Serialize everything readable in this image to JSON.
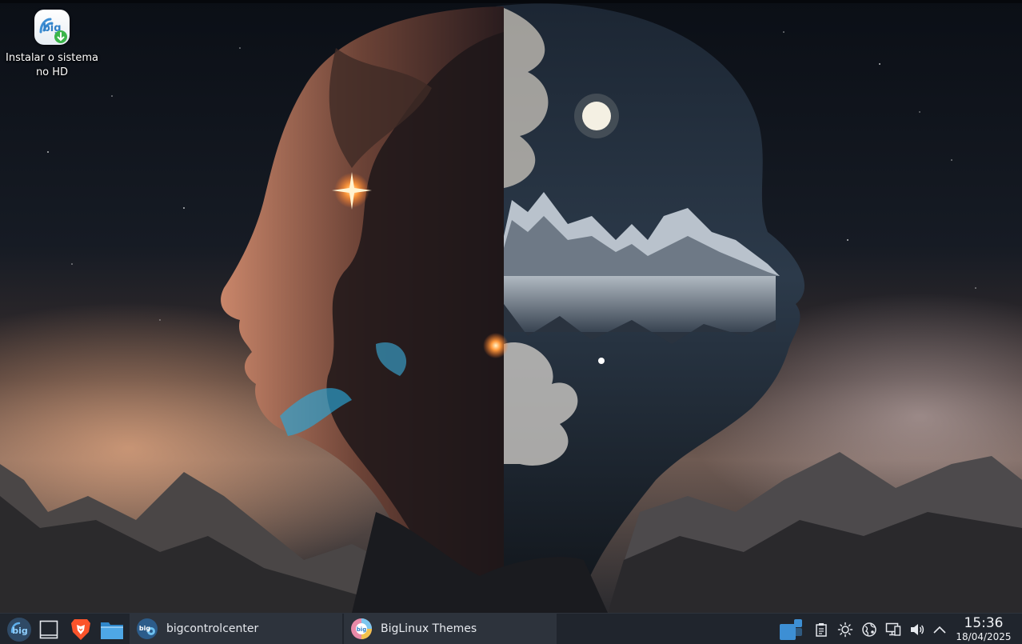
{
  "desktop": {
    "icons": [
      {
        "label_line1": "Instalar o sistema",
        "label_line2": "no HD",
        "icon": "biglinux-install-icon"
      }
    ]
  },
  "taskbar": {
    "launchers": [
      {
        "name": "biglinux-menu",
        "icon": "biglinux-logo-icon"
      },
      {
        "name": "show-desktop",
        "icon": "show-desktop-icon"
      },
      {
        "name": "brave-browser",
        "icon": "brave-lion-icon"
      },
      {
        "name": "file-manager",
        "icon": "folder-icon"
      }
    ],
    "tasks": [
      {
        "label": "bigcontrolcenter",
        "icon": "bigcontrolcenter-icon"
      },
      {
        "label": "BigLinux Themes",
        "icon": "biglinux-themes-icon"
      }
    ],
    "tray": [
      {
        "name": "virtual-desktops",
        "icon": "pager-icon"
      },
      {
        "name": "clipboard",
        "icon": "clipboard-icon"
      },
      {
        "name": "brightness",
        "icon": "brightness-icon"
      },
      {
        "name": "network",
        "icon": "network-icon"
      },
      {
        "name": "display",
        "icon": "display-icon"
      },
      {
        "name": "volume",
        "icon": "volume-icon"
      },
      {
        "name": "show-hidden",
        "icon": "chevron-up-icon"
      }
    ],
    "clock": {
      "time": "15:36",
      "date": "18/04/2025"
    }
  },
  "colors": {
    "taskbar_bg": "#20252d",
    "accent": "#3d8fd4"
  }
}
